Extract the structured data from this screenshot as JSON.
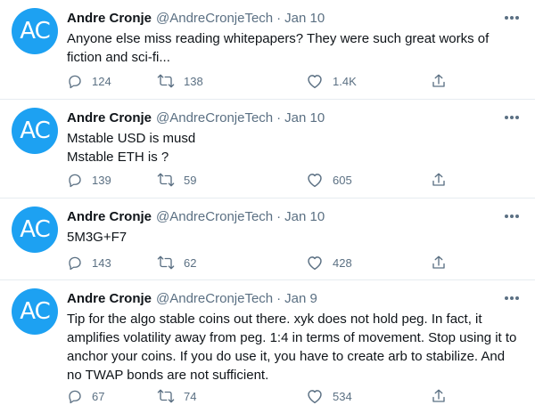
{
  "tweets": [
    {
      "avatar_initials": "AC",
      "name": "Andre Cronje",
      "handle": "@AndreCronjeTech",
      "separator": "·",
      "date": "Jan 10",
      "text": "Anyone else miss reading whitepapers? They were such great works of\nfiction and sci-fi...",
      "replies": "124",
      "retweets": "138",
      "likes": "1.4K"
    },
    {
      "avatar_initials": "AC",
      "name": "Andre Cronje",
      "handle": "@AndreCronjeTech",
      "separator": "·",
      "date": "Jan 10",
      "text": "Mstable USD is musd\nMstable ETH is ?",
      "replies": "139",
      "retweets": "59",
      "likes": "605"
    },
    {
      "avatar_initials": "AC",
      "name": "Andre Cronje",
      "handle": "@AndreCronjeTech",
      "separator": "·",
      "date": "Jan 10",
      "text": "5M3G+F7",
      "replies": "143",
      "retweets": "62",
      "likes": "428"
    },
    {
      "avatar_initials": "AC",
      "name": "Andre Cronje",
      "handle": "@AndreCronjeTech",
      "separator": "·",
      "date": "Jan 9",
      "text": "Tip for the algo stable coins out there. xyk does not hold peg. In fact, it\namplifies volatility away from peg. 1:4 in terms of movement. Stop using it to\nanchor your coins. If you do use it, you have to create arb to stabilize. And\nno TWAP bonds are not sufficient.",
      "replies": "67",
      "retweets": "74",
      "likes": "534"
    }
  ],
  "colors": {
    "avatar_bg": "#1da1f2",
    "secondary_text": "#5b7083",
    "primary_text": "#0f1419",
    "divider": "#e6ecf0"
  },
  "icons": {
    "more": "more-horizontal-icon",
    "reply": "reply-icon",
    "retweet": "retweet-icon",
    "like": "like-heart-icon",
    "share": "share-icon"
  }
}
